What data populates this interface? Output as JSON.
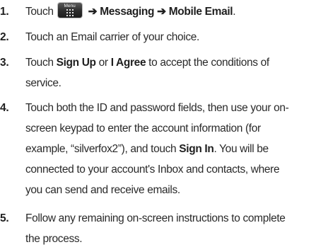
{
  "steps": [
    {
      "number": "1.",
      "lines": [
        {
          "before": "Touch",
          "menu_key_label": "Menu",
          "path": "➔ Messaging ➔ Mobile Email",
          "after": "."
        }
      ]
    },
    {
      "number": "2.",
      "lines": [
        {
          "text": "Touch an Email carrier of your choice."
        }
      ]
    },
    {
      "number": "3.",
      "lines": [
        {
          "t1": "Touch ",
          "b1": "Sign Up",
          "t2": " or ",
          "b2": "I Agree",
          "t3": " to accept the conditions of"
        },
        {
          "text": "service."
        }
      ]
    },
    {
      "number": "4.",
      "lines": [
        {
          "text": "Touch both the ID and password fields, then use your on-"
        },
        {
          "text": "screen keypad to enter the account information (for"
        },
        {
          "t1": "example, “silverfox2”), and touch ",
          "b1": "Sign In",
          "t2": ". You will be"
        },
        {
          "text": "connected to your account's Inbox and contacts, where"
        },
        {
          "text": "you can send and receive emails."
        }
      ]
    },
    {
      "number": "5.",
      "lines": [
        {
          "text": "Follow any remaining on-screen instructions to complete"
        },
        {
          "text": "the process."
        }
      ]
    }
  ],
  "icons": {
    "menu_key": "menu-grid-icon"
  },
  "colors": {
    "text": "#2a2a2a",
    "numbers": "#1f1f1f",
    "menu_key_background": "#2c2c2c"
  }
}
